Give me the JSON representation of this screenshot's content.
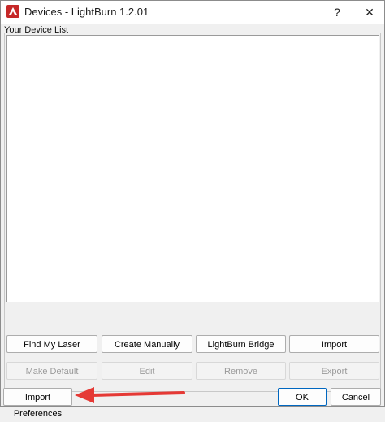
{
  "window": {
    "title": "Devices - LightBurn 1.2.01",
    "help_glyph": "?",
    "close_glyph": "✕"
  },
  "device_list": {
    "label": "Your Device List",
    "items": []
  },
  "actions_row1": {
    "find_my_laser": "Find My Laser",
    "create_manually": "Create Manually",
    "lightburn_bridge": "LightBurn Bridge",
    "import": "Import"
  },
  "actions_row2": {
    "make_default": "Make Default",
    "edit": "Edit",
    "remove": "Remove",
    "export": "Export"
  },
  "footer": {
    "import_preferences": "Import Preferences",
    "ok": "OK",
    "cancel": "Cancel"
  },
  "colors": {
    "annotation_arrow": "#e53935",
    "default_button_border": "#0067c0"
  }
}
